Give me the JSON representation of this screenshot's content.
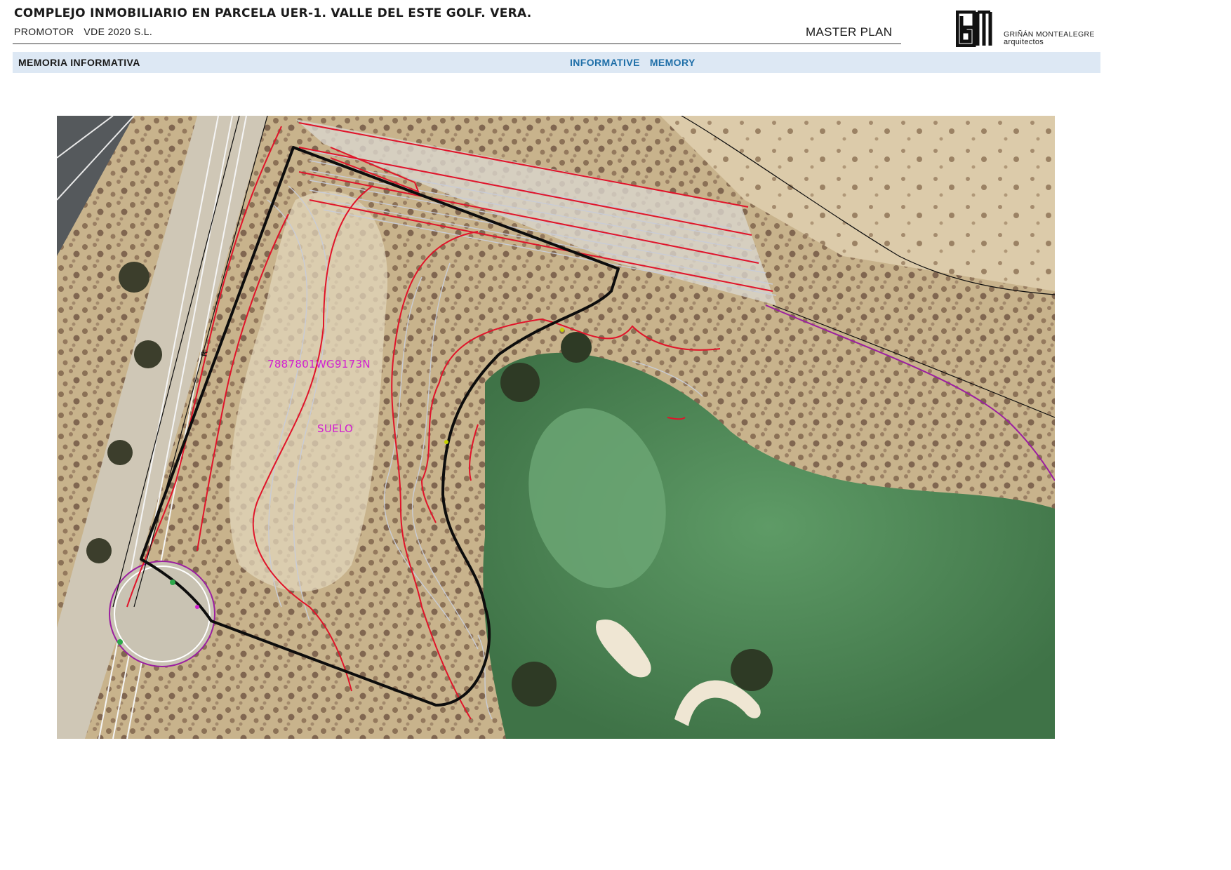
{
  "header": {
    "title": "COMPLEJO INMOBILIARIO EN PARCELA UER-1. VALLE DEL ESTE GOLF. VERA.",
    "promotor_label": "PROMOTOR",
    "promotor_value": "VDE 2020 S.L.",
    "document_type": "MASTER PLAN"
  },
  "logo": {
    "icon": "gm-monogram-logo",
    "line1": "GRIÑÁN MONTEALEGRE",
    "line2": "arquitectos"
  },
  "section_band": {
    "left": "MEMORIA INFORMATIVA",
    "center_word1": "INFORMATIVE",
    "center_word2": "MEMORY"
  },
  "map": {
    "type": "aerial orthophoto with cadastral overlay",
    "labels": {
      "cadastral_ref": "7887801WG9173N",
      "land_class": "SUELO",
      "road_mark": "R"
    },
    "colors": {
      "plot_boundary": "#0d0d0d",
      "contour_major": "#e0142a",
      "contour_minor": "#c9ccd6",
      "cadastral_text": "#d21fd0",
      "parcel_line": "#9b1fa0",
      "terrain": "#c9b58f",
      "golf_green": "#4f8a55"
    }
  }
}
